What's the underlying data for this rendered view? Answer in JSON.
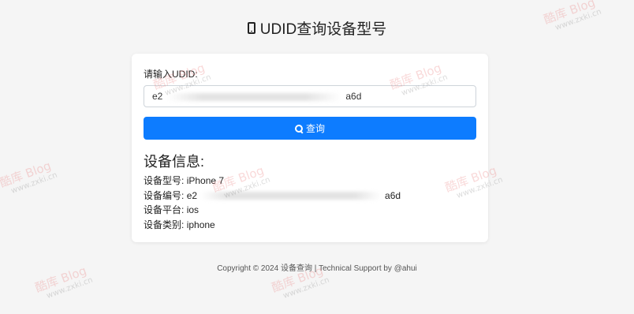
{
  "header": {
    "title": "UDID查询设备型号",
    "icon": "phone-icon"
  },
  "form": {
    "label": "请输入UDID:",
    "udid_start": "e2",
    "udid_end": "a6d",
    "submit_label": "查询",
    "submit_icon": "search-icon",
    "accent_color": "#0d7cff"
  },
  "info": {
    "heading": "设备信息:",
    "rows": [
      {
        "label": "设备型号:",
        "value": "iPhone 7"
      },
      {
        "label": "设备编号:",
        "value_start": "e2",
        "value_end": "a6d"
      },
      {
        "label": "设备平台:",
        "value": "ios"
      },
      {
        "label": "设备类别:",
        "value": "iphone"
      }
    ]
  },
  "footer": {
    "text": "Copyright © 2024 设备查询 | Technical Support by @ahui"
  },
  "watermark": {
    "brand": "酷库 Blog",
    "url": "www.zxki.cn"
  }
}
